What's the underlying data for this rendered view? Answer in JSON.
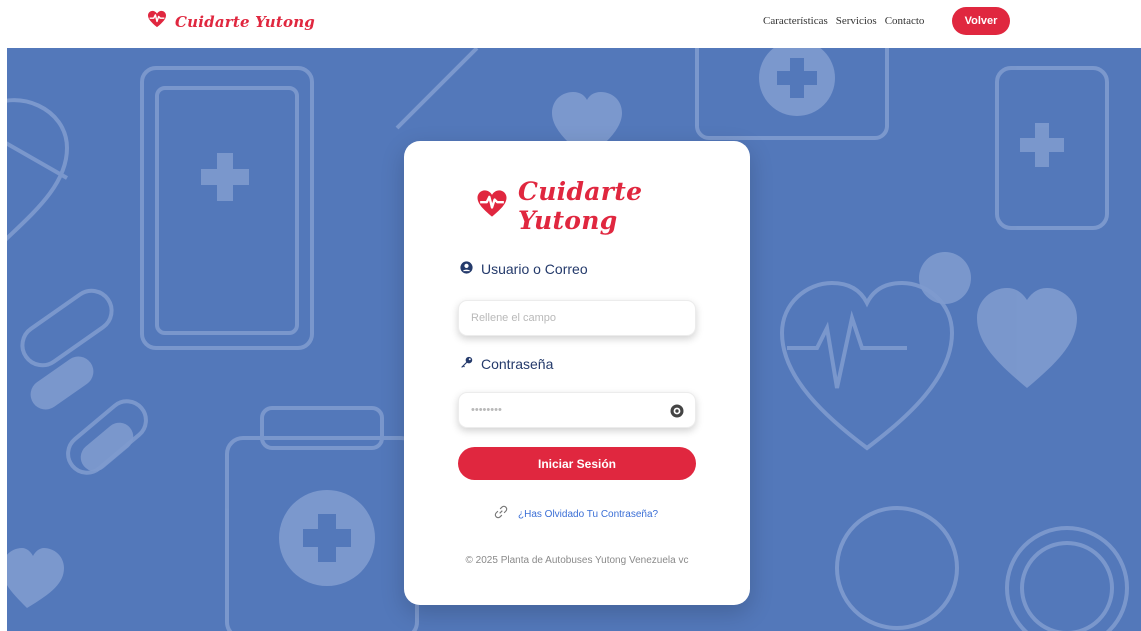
{
  "colors": {
    "accent": "#e0273f",
    "background": "#5378ba",
    "link": "#3b6fd6",
    "label": "#243a6b"
  },
  "navbar": {
    "brand_name": "Cuidarte Yutong",
    "links": [
      {
        "label": "Características"
      },
      {
        "label": "Servicios"
      },
      {
        "label": "Contacto"
      }
    ],
    "back_button_label": "Volver",
    "logo_icon": "heart-pulse-icon"
  },
  "login": {
    "brand_name": "Cuidarte Yutong",
    "username": {
      "label": "Usuario o Correo",
      "placeholder": "Rellene el campo",
      "value": "",
      "icon": "user-circle-icon"
    },
    "password": {
      "label": "Contraseña",
      "placeholder": "••••••••",
      "value": "",
      "icon": "key-icon",
      "toggle_icon": "eye-icon"
    },
    "submit_label": "Iniciar Sesión",
    "forgot_label": "¿Has Olvidado Tu Contraseña?",
    "forgot_icon": "link-icon",
    "footer": "© 2025 Planta de Autobuses Yutong Venezuela vc"
  }
}
